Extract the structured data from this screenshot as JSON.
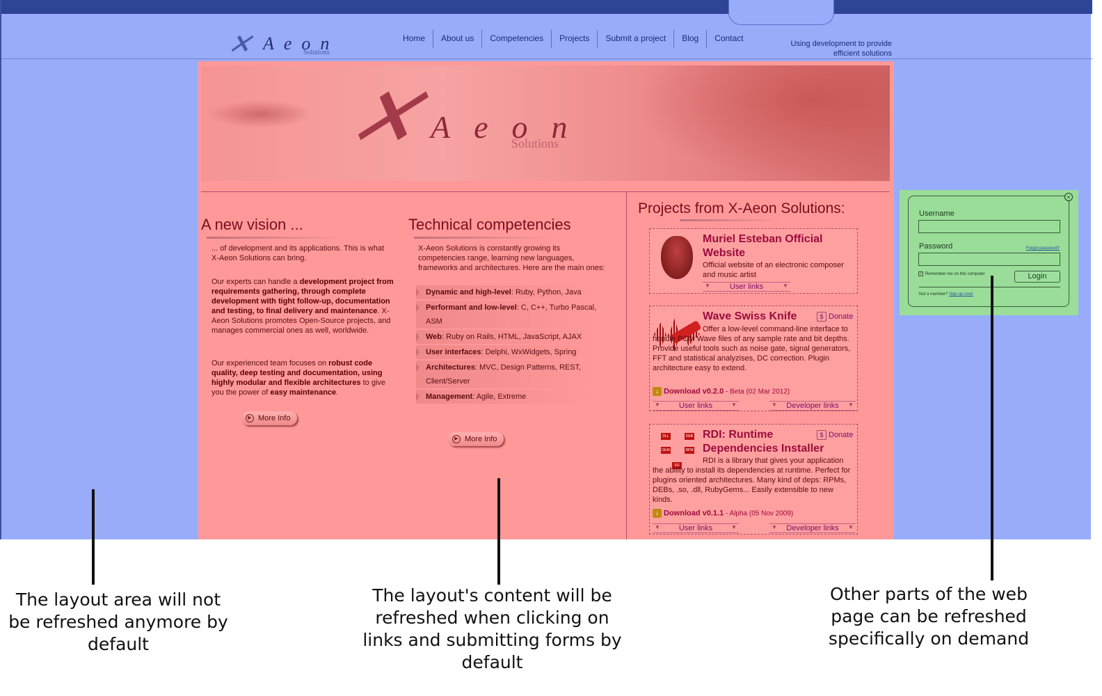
{
  "header": {
    "logo": {
      "word": "Aeon",
      "sub": "Solutions"
    },
    "nav": [
      "Home",
      "About us",
      "Competencies",
      "Projects",
      "Submit a project",
      "Blog",
      "Contact"
    ],
    "tagline_line1": "Using development to provide",
    "tagline_line2": "efficient solutions"
  },
  "banner": {
    "word": "Aeon",
    "sub": "Solutions"
  },
  "vision": {
    "title": "A new vision ...",
    "p1": "... of development and its applications. This is what X-Aeon Solutions can bring.",
    "p2_a": "Our experts can handle a ",
    "p2_b": "development project from requirements gathering, through complete development with tight follow-up, documentation and testing, to final delivery and maintenance",
    "p2_c": ". X-Aeon Solutions promotes Open-Source projects, and manages commercial ones as well, worldwide.",
    "p3_a": "Our experienced team focuses on ",
    "p3_b": "robust code quality, deep testing and documentation, using highly modular and flexible architectures",
    "p3_c": " to give you the power of ",
    "p3_d": "easy maintenance",
    "p3_e": ".",
    "more": "More Info"
  },
  "competencies": {
    "title": "Technical competencies",
    "intro": "X-Aeon Solutions is constantly growing its competencies range, learning new languages, frameworks and architectures. Here are the main ones:",
    "items": [
      {
        "k": "Dynamic and high-level",
        "v": ": Ruby, Python, Java"
      },
      {
        "k": "Performant and low-level",
        "v": ": C, C++, Turbo Pascal, ASM"
      },
      {
        "k": "Web",
        "v": ": Ruby on Rails, HTML, JavaScript, AJAX"
      },
      {
        "k": "User interfaces",
        "v": ": Delphi, WxWidgets, Spring"
      },
      {
        "k": "Architectures",
        "v": ": MVC, Design Patterns, REST, Client/Server"
      },
      {
        "k": "Management",
        "v": ": Agile, Extreme"
      }
    ],
    "more": "More Info"
  },
  "projects": {
    "title": "Projects from X-Aeon Solutions:",
    "p1": {
      "name": "Muriel Esteban Official Website",
      "desc": "Official website of an electronic composer and music artist",
      "user_links": "User links"
    },
    "p2": {
      "name": "Wave Swiss Knife",
      "donate": "Donate",
      "desc": "Offer a low-level command-line interface to handle PCM Wave files of any sample rate and bit depths. Provide useful tools such as noise gate, signal generators, FFT and statistical analyzises, DC correction. Plugin architecture easy to extend.",
      "download": "Download v0.2.0",
      "download_note": " - Beta (02 Mar 2012)",
      "user_links": "User links",
      "dev_links": "Developer links"
    },
    "p3": {
      "name": "RDI: Runtime Dependencies Installer",
      "donate": "Donate",
      "desc": "RDI is a library that gives your application the ability to install its dependencies at runtime. Perfect for plugins oriented architectures. Many kind of deps: RPMs, DEBs, .so, .dll, RubyGems... Easily extensible to new kinds.",
      "download": "Download v0.1.1",
      "download_note": " - Alpha (05 Nov 2009)",
      "user_links": "User links",
      "dev_links": "Developer links",
      "graph_labels": [
        "DLL",
        "DEB",
        "GEM",
        "RPM",
        "SO"
      ]
    }
  },
  "login": {
    "username": "Username",
    "password": "Password",
    "forgot": "Forgot password?",
    "remember": "Remember me on this computer",
    "button": "Login",
    "member_q": "Not a member? ",
    "signup": "Sign up now!"
  },
  "captions": {
    "left": "The layout area will not be refreshed anymore by default",
    "center": "The layout's content will be refreshed when clicking on links and submitting forms by default",
    "right": "Other parts of the web page can be refreshed specifically on demand"
  },
  "colors": {
    "layout": "#98acfa",
    "content": "#ff9999",
    "partial": "#99dd99"
  }
}
